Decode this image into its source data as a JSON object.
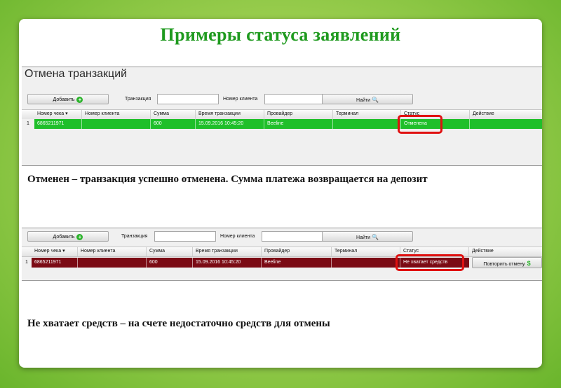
{
  "slide": {
    "title": "Примеры статуса заявлений",
    "description_1": "Отменен – транзакция успешно отменена. Сумма платежа возвращается на депозит",
    "description_2": "Не хватает средств – на счете недостаточно средств для отмены"
  },
  "window": {
    "title": "Отмена транзакций"
  },
  "toolbar": {
    "add_label": "Добавить",
    "transaction_label": "Транзакция",
    "client_label": "Номер клиента",
    "find_label": "Найти",
    "transaction_value": "",
    "client_value": ""
  },
  "table": {
    "headers": [
      "Номер чека ▾",
      "Номер клиента",
      "Сумма",
      "Время транзакции",
      "Провайдер",
      "Терминал",
      "Статус",
      "Действие"
    ]
  },
  "example_1": {
    "row_num": "1",
    "check": "6865211971",
    "client": "",
    "sum": "600",
    "time": "15.09.2016 10:45:20",
    "provider": "Beeline",
    "terminal": "",
    "status": "Отменена",
    "action": ""
  },
  "example_2": {
    "row_num": "1",
    "check": "6865211971",
    "client": "",
    "sum": "600",
    "time": "15.09.2016 10:45:20",
    "provider": "Beeline",
    "terminal": "",
    "status": "Не хватает средств",
    "action": "Повторить отмену"
  },
  "colors": {
    "title": "#1f9a1f",
    "row_cancelled": "#1fbf2a",
    "row_insufficient": "#7b0a14",
    "highlight": "#e01010"
  },
  "icons": [
    "add-icon",
    "search-icon",
    "dollar-icon"
  ]
}
